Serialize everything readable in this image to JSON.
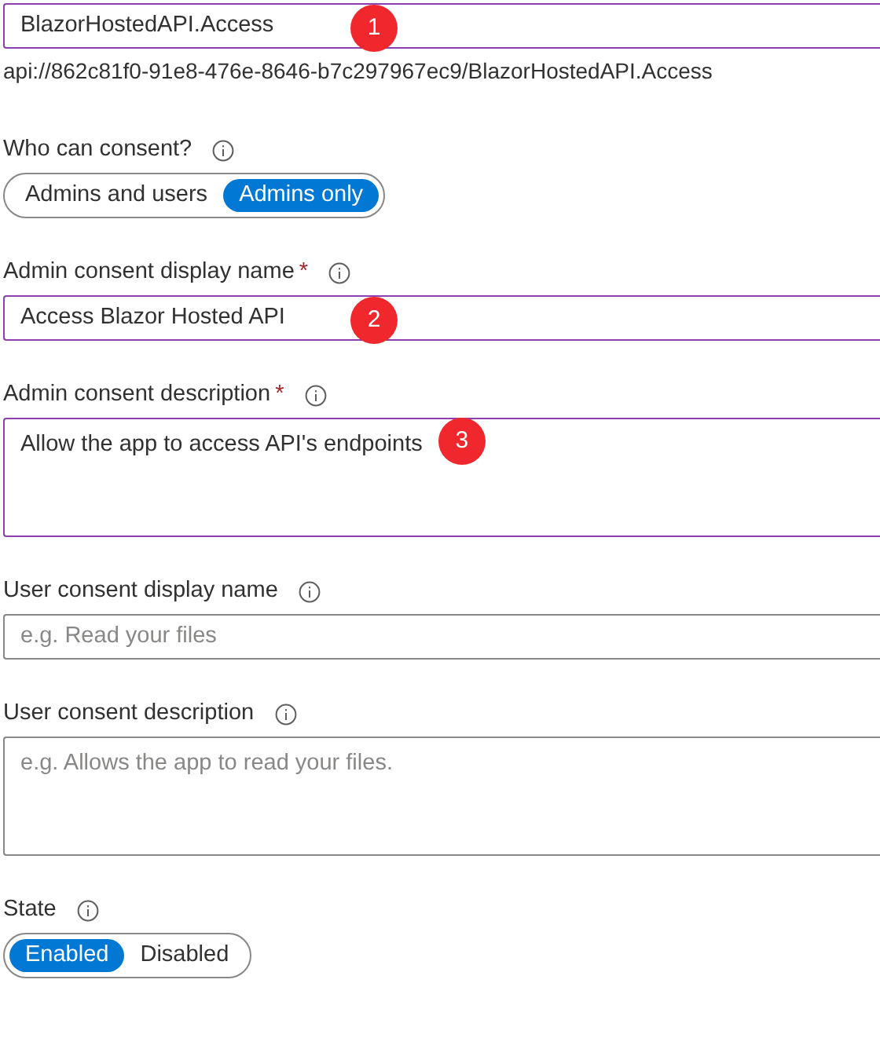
{
  "fields": [
    {
      "kind": "text",
      "value": "BlazorHostedAPI.Access",
      "focused": true,
      "badge": "1",
      "helper": "api://862c81f0-91e8-476e-8646-b7c297967ec9/BlazorHostedAPI.Access"
    },
    {
      "kind": "toggle",
      "label": "Who can consent?",
      "info": true,
      "options": [
        {
          "label": "Admins and users",
          "selected": false
        },
        {
          "label": "Admins only",
          "selected": true
        }
      ]
    },
    {
      "kind": "text",
      "label": "Admin consent display name",
      "required_mark": "*",
      "info": true,
      "value": "Access Blazor Hosted API",
      "focused": true,
      "badge": "2"
    },
    {
      "kind": "textarea",
      "label": "Admin consent description",
      "required_mark": "*",
      "info": true,
      "value": "Allow the app to access API's endpoints",
      "focused": true,
      "badge": "3"
    },
    {
      "kind": "text",
      "label": "User consent display name",
      "info": true,
      "placeholder": "e.g. Read your files",
      "focused": false
    },
    {
      "kind": "textarea",
      "label": "User consent description",
      "info": true,
      "placeholder": "e.g. Allows the app to read your files.",
      "focused": false
    },
    {
      "kind": "toggle",
      "label": "State",
      "info": true,
      "options": [
        {
          "label": "Enabled",
          "selected": true
        },
        {
          "label": "Disabled",
          "selected": false
        }
      ]
    }
  ]
}
